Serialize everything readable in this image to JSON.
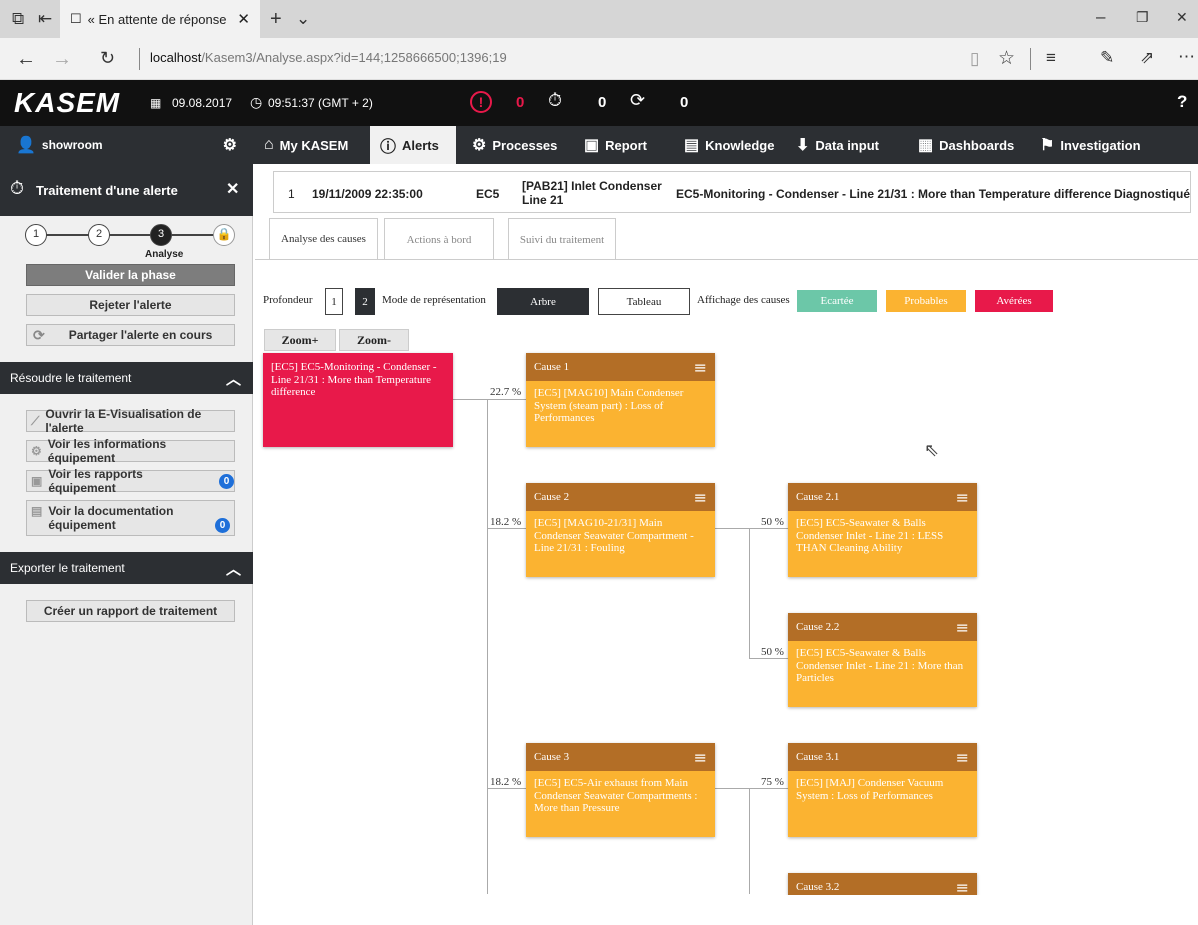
{
  "browser": {
    "tab_title": "« En attente de réponse",
    "url_host": "localhost",
    "url_path": "/Kasem3/Analyse.aspx?id=144;1258666500;1396;19"
  },
  "app": {
    "logo": "KASEM",
    "date": "09.08.2017",
    "time": "09:51:37 (GMT + 2)",
    "count_alerts": "0",
    "count_pending": "0",
    "count_shared": "0",
    "help": "?"
  },
  "nav": {
    "user": "showroom",
    "items": [
      "My KASEM",
      "Alerts",
      "Processes",
      "Report",
      "Knowledge",
      "Data input",
      "Dashboards",
      "Investigation"
    ]
  },
  "sidebar": {
    "title": "Traitement d'une alerte",
    "steps": [
      "1",
      "2",
      "3"
    ],
    "step_label": "Analyse",
    "btn_validate": "Valider la phase",
    "btn_reject": "Rejeter l'alerte",
    "btn_share": "Partager l'alerte en cours",
    "section_resolve": "Résoudre le traitement",
    "btn_evis": "Ouvrir la E-Visualisation de l'alerte",
    "btn_equip_info": "Voir les informations équipement",
    "btn_equip_reports": "Voir les rapports équipement",
    "btn_equip_reports_count": "0",
    "btn_equip_doc": "Voir la documentation équipement",
    "btn_equip_doc_count": "0",
    "section_export": "Exporter le traitement",
    "btn_create_report": "Créer un rapport de traitement"
  },
  "alert": {
    "num": "1",
    "datetime": "19/11/2009 22:35:00",
    "unit": "EC5",
    "equipment": "[PAB21] Inlet Condenser Line 21",
    "description": "EC5-Monitoring - Condenser - Line 21/31 : More than Temperature difference",
    "status": "Diagnostiqué"
  },
  "subtabs": [
    "Analyse des causes",
    "Actions à bord",
    "Suivi du traitement"
  ],
  "controls": {
    "depth_label": "Profondeur",
    "depth_1": "1",
    "depth_2": "2",
    "mode_label": "Mode de représentation",
    "mode_tree": "Arbre",
    "mode_table": "Tableau",
    "display_label": "Affichage des causes",
    "filter_rejected": "Ecartée",
    "filter_probable": "Probables",
    "filter_proven": "Avérées",
    "zoom_in": "Zoom+",
    "zoom_out": "Zoom-"
  },
  "tree": {
    "root": "[EC5] EC5-Monitoring - Condenser - Line 21/31 : More than Temperature difference",
    "causes": [
      {
        "title": "Cause 1",
        "pct": "22.7 %",
        "text": "[EC5] [MAG10] Main Condenser System (steam part) : Loss of Performances"
      },
      {
        "title": "Cause 2",
        "pct": "18.2 %",
        "text": "[EC5] [MAG10-21/31] Main Condenser Seawater Compartment - Line 21/31 : Fouling"
      },
      {
        "title": "Cause 3",
        "pct": "18.2 %",
        "text": "[EC5] EC5-Air exhaust from Main Condenser Seawater Compartments : More than Pressure"
      }
    ],
    "subcauses": [
      {
        "title": "Cause 2.1",
        "pct": "50 %",
        "text": "[EC5] EC5-Seawater & Balls Condenser Inlet - Line 21 : LESS THAN Cleaning Ability"
      },
      {
        "title": "Cause 2.2",
        "pct": "50 %",
        "text": "[EC5] EC5-Seawater & Balls Condenser Inlet - Line 21 : More than Particles"
      },
      {
        "title": "Cause 3.1",
        "pct": "75 %",
        "text": "[EC5] [MAJ] Condenser Vacuum System : Loss of Performances"
      },
      {
        "title": "Cause 3.2",
        "pct": "",
        "text": ""
      }
    ]
  },
  "colors": {
    "root": "#e8194a",
    "cause": "#fbb331",
    "cause_header": "#b36e26",
    "rejected": "#6cc7a8",
    "probable": "#fbb331",
    "proven": "#e8194a"
  }
}
